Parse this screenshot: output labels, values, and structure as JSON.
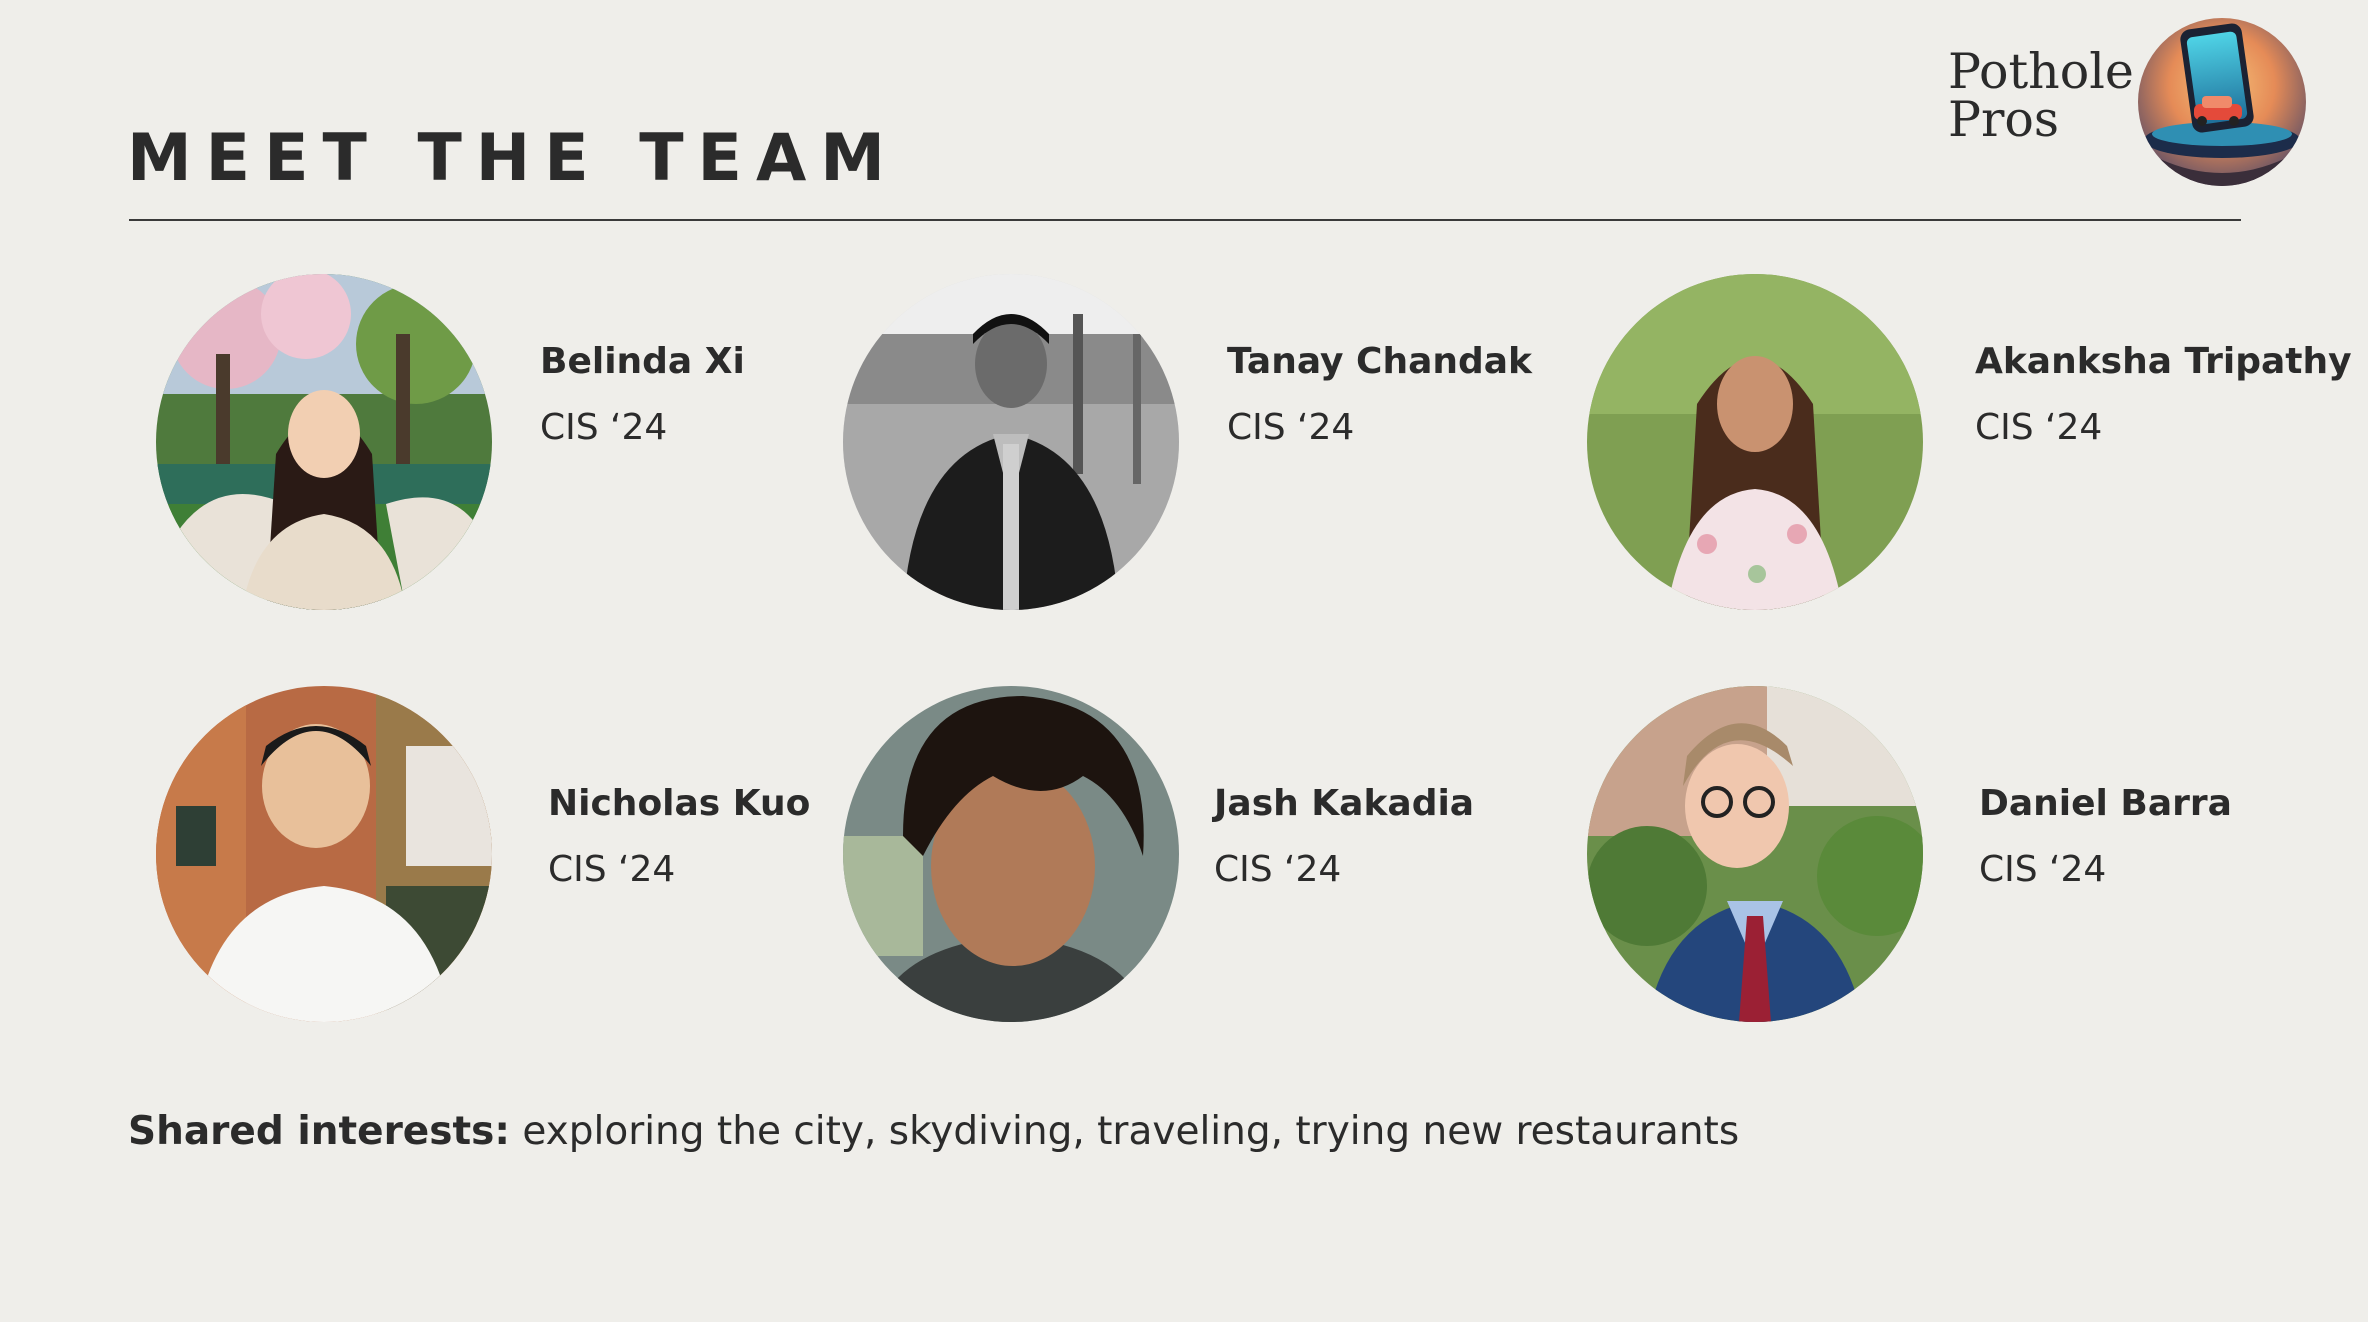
{
  "slide": {
    "title": "MEET THE TEAM"
  },
  "brand": {
    "line1": "Pothole",
    "line2": "Pros",
    "logo_icon": "phone-car-pothole-logo-icon"
  },
  "team": [
    {
      "name": "Belinda Xi",
      "class": "CIS ‘24"
    },
    {
      "name": "Tanay Chandak",
      "class": "CIS ‘24"
    },
    {
      "name": "Akanksha Tripathy",
      "class": "CIS ‘24"
    },
    {
      "name": "Nicholas Kuo",
      "class": "CIS ‘24"
    },
    {
      "name": "Jash Kakadia",
      "class": "CIS ‘24"
    },
    {
      "name": "Daniel Barra",
      "class": "CIS ‘24"
    }
  ],
  "interests": {
    "label": "Shared interests",
    "separator": ":",
    "text": " exploring the city, skydiving, traveling, trying new restaurants"
  }
}
